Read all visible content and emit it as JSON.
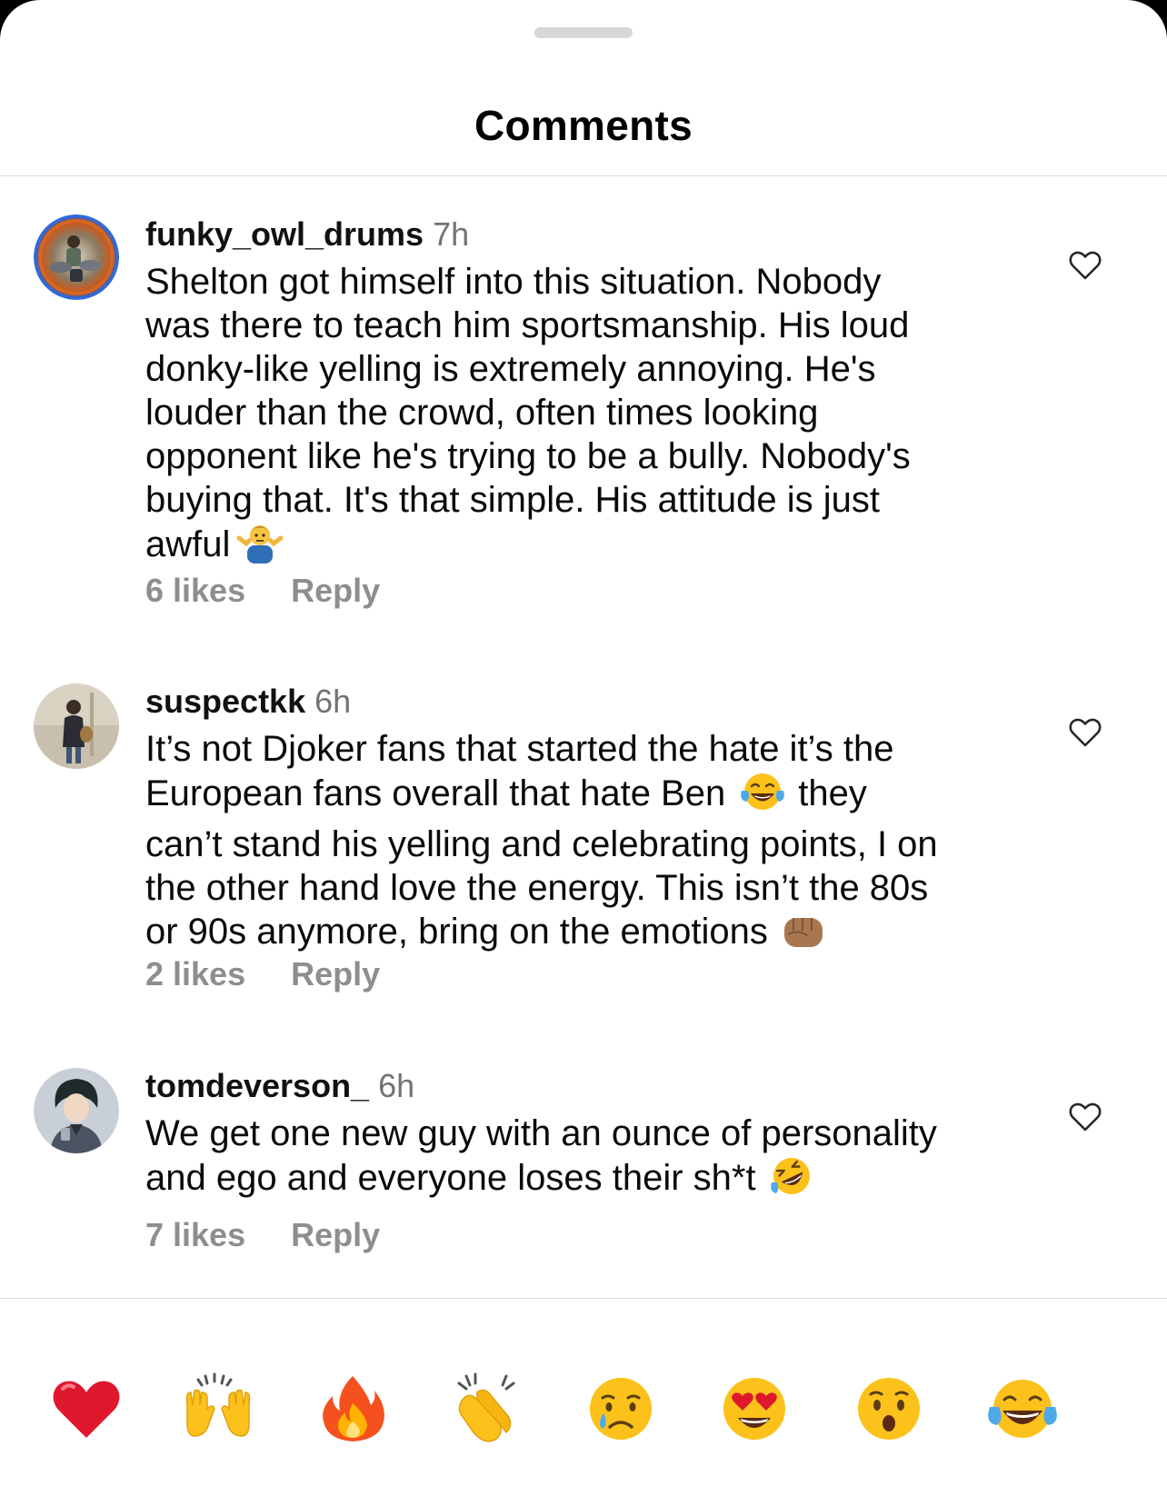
{
  "sheet": {
    "title": "Comments"
  },
  "comments": [
    {
      "username": "funky_owl_drums",
      "time": "7h",
      "lines": [
        "Shelton got himself into this situation. Nobody",
        "was there to teach him sportsmanship. His loud",
        "donky-like yelling is extremely annoying. He's",
        "louder than the crowd, often times looking",
        "opponent like he's trying to be a bully. Nobody's",
        "buying that. It's that simple. His attitude is just",
        "awful"
      ],
      "emoji": "man-shrugging-emoji",
      "likes": "6 likes",
      "reply": "Reply",
      "avatar_icon": "drummer-avatar-icon"
    },
    {
      "username": "suspectkk",
      "time": "6h",
      "lines": [
        "It’s not Djoker fans that started the hate it’s the",
        "European fans overall that hate Ben",
        "can’t stand his yelling and celebrating points, I on",
        "the other hand love the energy. This isn’t the 80s",
        "or 90s anymore, bring on the emotions"
      ],
      "line2_tail": "they",
      "emoji_inline": "tears-of-joy-emoji",
      "emoji": "fist-emoji",
      "likes": "2 likes",
      "reply": "Reply",
      "avatar_icon": "person-photo-avatar-icon"
    },
    {
      "username": "tomdeverson_",
      "time": "6h",
      "lines": [
        "We get one new guy with an ounce of personality",
        "and ego and everyone loses their sh*t"
      ],
      "emoji": "rofl-emoji",
      "likes": "7 likes",
      "reply": "Reply",
      "avatar_icon": "anime-avatar-icon"
    }
  ],
  "reactions": [
    "red-heart-emoji",
    "raising-hands-emoji",
    "fire-emoji",
    "clapping-hands-emoji",
    "crying-face-emoji",
    "heart-eyes-emoji",
    "surprised-face-emoji",
    "tears-of-joy-emoji"
  ],
  "colors": {
    "username": "#111111",
    "meta": "#8e8e8e",
    "divider": "#dbdbdb",
    "heart": "#ed2b3b",
    "emoji_yellow": "#fcc21b"
  }
}
